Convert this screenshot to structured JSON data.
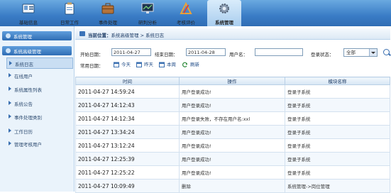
{
  "nav": {
    "items": [
      {
        "label": "基础信息",
        "icon": "info-card-icon"
      },
      {
        "label": "日常工作",
        "icon": "clipboard-icon"
      },
      {
        "label": "事件处理",
        "icon": "briefcase-icon"
      },
      {
        "label": "研判分析",
        "icon": "monitor-chart-icon"
      },
      {
        "label": "考核评价",
        "icon": "pencil-ruler-icon"
      },
      {
        "label": "系统管理",
        "icon": "gear-icon"
      }
    ],
    "active_index": 5
  },
  "sidebar": {
    "group1": "系统管理",
    "group2": "系统高级管理",
    "items": [
      "系统日志",
      "在线用户",
      "系统属性列表",
      "系统公告",
      "事件处理类别",
      "工作日历",
      "管理考核用户"
    ],
    "selected_index": 0
  },
  "breadcrumb": {
    "prefix": "当前位置：",
    "path": "系统高级管理 > 系统日志"
  },
  "filters": {
    "start_label": "开始日期：",
    "start_value": "2011-04-27",
    "end_label": "结束日期：",
    "end_value": "2011-04-28",
    "user_label": "用户名：",
    "user_value": "",
    "status_label": "登录状态：",
    "status_value": "全部",
    "common_label": "常用日期：",
    "today": "今天",
    "yesterday": "昨天",
    "this_week": "本周",
    "refresh": "刷新"
  },
  "table": {
    "headers": [
      "时间",
      "操作",
      "模块名称"
    ],
    "rows": [
      [
        "2011-04-27 14:59:24",
        "用户登录成功!",
        "登录子系统"
      ],
      [
        "2011-04-27 14:12:43",
        "用户登录成功!",
        "登录子系统"
      ],
      [
        "2011-04-27 14:12:34",
        "用户登录失败，不存在用户名:xxl",
        "登录子系统"
      ],
      [
        "2011-04-27 13:34:24",
        "用户登录成功!",
        "登录子系统"
      ],
      [
        "2011-04-27 13:12:24",
        "用户登录成功!",
        "登录子系统"
      ],
      [
        "2011-04-27 12:25:39",
        "用户登录成功!",
        "登录子系统"
      ],
      [
        "2011-04-27 12:25:22",
        "用户登录成功!",
        "登录子系统"
      ],
      [
        "2011-04-27 10:09:49",
        "删除",
        "系统管理->岗位管理"
      ]
    ]
  },
  "colors": {
    "nav_bg": "#3a7cc6",
    "accent": "#2f6db4"
  }
}
